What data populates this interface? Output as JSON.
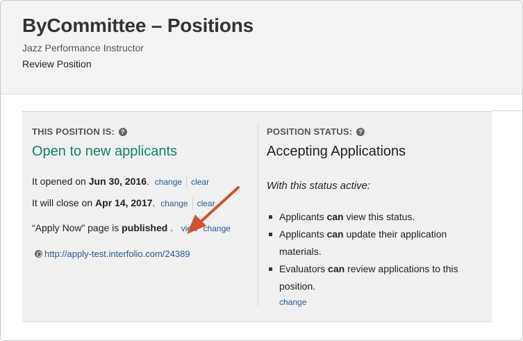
{
  "header": {
    "title": "ByCommittee – Positions",
    "subtitle": "Jazz Performance Instructor",
    "breadcrumb": "Review Position"
  },
  "position": {
    "heading": "THIS POSITION IS:",
    "status": "Open to new applicants",
    "opened": {
      "prefix": "It opened on",
      "date": "Jun 30, 2016",
      "suffix": ".",
      "change_label": "change",
      "clear_label": "clear"
    },
    "closes": {
      "prefix": "It will close on",
      "date": "Apr 14, 2017",
      "suffix": ".",
      "change_label": "change",
      "clear_label": "clear"
    },
    "apply_page": {
      "prefix": "“Apply Now” page is",
      "state": "published",
      "suffix": " .",
      "view_label": "view",
      "change_label": "change"
    },
    "url": "http://apply-test.interfolio.com/24389"
  },
  "status_panel": {
    "heading": "POSITION STATUS:",
    "status": "Accepting Applications",
    "with_status": "With this status active:",
    "rules": [
      {
        "pre": "Applicants",
        "bold": "can",
        "post": "view this status."
      },
      {
        "pre": "Applicants",
        "bold": "can",
        "post": "update their application materials."
      },
      {
        "pre": "Evaluators",
        "bold": "can",
        "post": "review applications to this position."
      }
    ],
    "change_label": "change"
  },
  "colors": {
    "open_status": "#13826b",
    "link": "#2a5a8c",
    "annotation_arrow": "#d0532f"
  },
  "icons": [
    "help-icon",
    "globe-icon",
    "annotation-arrow"
  ]
}
